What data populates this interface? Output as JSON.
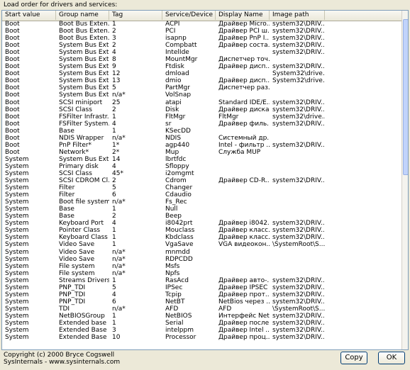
{
  "caption": "Load order for drivers and services:",
  "columns": [
    "Start value",
    "Group name",
    "Tag",
    "Service/Device",
    "Display Name",
    "Image path"
  ],
  "rows": [
    [
      "Boot",
      "Boot Bus Exten...",
      "1",
      "ACPI",
      "Драйвер Micro...",
      "system32\\DRIV..."
    ],
    [
      "Boot",
      "Boot Bus Exten...",
      "2",
      "PCI",
      "Драйвер PCI ш...",
      "system32\\DRIV..."
    ],
    [
      "Boot",
      "Boot Bus Exten...",
      "3",
      "isapnp",
      "Драйвер PnP I...",
      "system32\\DRIV..."
    ],
    [
      "Boot",
      "System Bus Ext...",
      "2",
      "Compbatt",
      "Драйвер соста...",
      "system32\\DRIV..."
    ],
    [
      "Boot",
      "System Bus Ext...",
      "4",
      "IntelIde",
      "",
      "system32\\DRIV..."
    ],
    [
      "Boot",
      "System Bus Ext...",
      "8",
      "MountMgr",
      "Диспетчер точ...",
      ""
    ],
    [
      "Boot",
      "System Bus Ext...",
      "9",
      "Ftdisk",
      "Драйвер дисп...",
      "system32\\DRIV..."
    ],
    [
      "Boot",
      "System Bus Ext...",
      "12",
      "dmload",
      "",
      "System32\\drive..."
    ],
    [
      "Boot",
      "System Bus Ext...",
      "13",
      "dmio",
      "Драйвер дисп...",
      "System32\\drive..."
    ],
    [
      "Boot",
      "System Bus Ext...",
      "5",
      "PartMgr",
      "Диспетчер раз...",
      ""
    ],
    [
      "Boot",
      "System Bus Ext...",
      "n/a*",
      "VolSnap",
      "",
      ""
    ],
    [
      "Boot",
      "SCSI miniport",
      "25",
      "atapi",
      "Standard IDE/E...",
      "system32\\DRIV..."
    ],
    [
      "Boot",
      "SCSI Class",
      "2",
      "Disk",
      "Драйвер диска",
      "system32\\DRIV..."
    ],
    [
      "Boot",
      "FSFilter Infrastr...",
      "1",
      "FltMgr",
      "FltMgr",
      "system32\\drive..."
    ],
    [
      "Boot",
      "FSFilter System...",
      "4",
      "sr",
      "Драйвер филь...",
      "system32\\DRIV..."
    ],
    [
      "Boot",
      "Base",
      "1",
      "KSecDD",
      "",
      ""
    ],
    [
      "Boot",
      "NDIS Wrapper",
      "n/a*",
      "NDIS",
      "Системный др...",
      ""
    ],
    [
      "Boot",
      "PnP Filter*",
      "1*",
      "agp440",
      "Intel - фильтр ...",
      "system32\\DRIV..."
    ],
    [
      "Boot",
      "Network*",
      "2*",
      "Mup",
      "Служба MUP",
      ""
    ],
    [
      "System",
      "System Bus Ext...",
      "14",
      "lbrtfdc",
      "",
      ""
    ],
    [
      "System",
      "Primary disk",
      "4",
      "Sfloppy",
      "",
      ""
    ],
    [
      "System",
      "SCSI Class",
      "45*",
      "i2omgmt",
      "",
      ""
    ],
    [
      "System",
      "SCSI CDROM Cl...",
      "2",
      "Cdrom",
      "Драйвер CD-R...",
      "system32\\DRIV..."
    ],
    [
      "System",
      "Filter",
      "5",
      "Changer",
      "",
      ""
    ],
    [
      "System",
      "Filter",
      "6",
      "Cdaudio",
      "",
      ""
    ],
    [
      "System",
      "Boot file system",
      "n/a*",
      "Fs_Rec",
      "",
      ""
    ],
    [
      "System",
      "Base",
      "1",
      "Null",
      "",
      ""
    ],
    [
      "System",
      "Base",
      "2",
      "Beep",
      "",
      ""
    ],
    [
      "System",
      "Keyboard Port",
      "4",
      "i8042prt",
      "Драйвер i8042...",
      "system32\\DRIV..."
    ],
    [
      "System",
      "Pointer Class",
      "1",
      "Mouclass",
      "Драйвер класс...",
      "system32\\DRIV..."
    ],
    [
      "System",
      "Keyboard Class",
      "1",
      "Kbdclass",
      "Драйвер класс...",
      "system32\\DRIV..."
    ],
    [
      "System",
      "Video Save",
      "1",
      "VgaSave",
      "VGA видеокон...",
      "\\SystemRoot\\S..."
    ],
    [
      "System",
      "Video Save",
      "n/a*",
      "mnmdd",
      "",
      ""
    ],
    [
      "System",
      "Video Save",
      "n/a*",
      "RDPCDD",
      "",
      ""
    ],
    [
      "System",
      "File system",
      "n/a*",
      "Msfs",
      "",
      ""
    ],
    [
      "System",
      "File system",
      "n/a*",
      "Npfs",
      "",
      ""
    ],
    [
      "System",
      "Streams Drivers",
      "1",
      "RasAcd",
      "Драйвер авто-...",
      "system32\\DRIV..."
    ],
    [
      "System",
      "PNP_TDI",
      "5",
      "IPSec",
      "Драйвер IPSEC",
      "system32\\DRIV..."
    ],
    [
      "System",
      "PNP_TDI",
      "4",
      "Tcpip",
      "Драйвер прот...",
      "system32\\DRIV..."
    ],
    [
      "System",
      "PNP_TDI",
      "6",
      "NetBT",
      "NetBios через ...",
      "system32\\DRIV..."
    ],
    [
      "System",
      "TDI",
      "n/a*",
      "AFD",
      "AFD",
      "\\SystemRoot\\S..."
    ],
    [
      "System",
      "NetBIOSGroup",
      "1",
      "NetBIOS",
      "Интерфейс Net...",
      "system32\\DRIV..."
    ],
    [
      "System",
      "Extended base",
      "1",
      "Serial",
      "Драйвер после...",
      "system32\\DRIV..."
    ],
    [
      "System",
      "Extended Base",
      "3",
      "intelppm",
      "Драйвер Intel ...",
      "system32\\DRIV..."
    ],
    [
      "System",
      "Extended Base",
      "10",
      "Processor",
      "Драйвер проц...",
      "system32\\DRIV..."
    ]
  ],
  "footer": {
    "copyright": "Copyright (c) 2000 Bryce Cogswell",
    "site": "SysInternals - www.sysinternals.com"
  },
  "buttons": {
    "copy": "Copy",
    "ok": "OK"
  }
}
